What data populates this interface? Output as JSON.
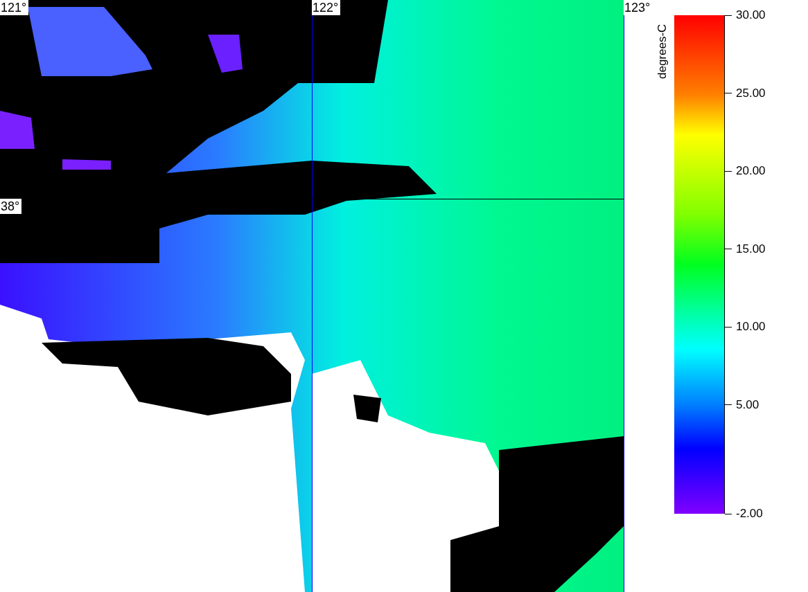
{
  "map": {
    "grid_labels": [
      {
        "kind": "lon",
        "text": "121°"
      },
      {
        "kind": "lon",
        "text": "122°"
      },
      {
        "kind": "lon",
        "text": "123°"
      },
      {
        "kind": "lat",
        "text": "38°"
      }
    ]
  },
  "colorbar": {
    "unit_label": "degrees-C",
    "ticks": [
      "30.00",
      "25.00",
      "20.00",
      "15.00",
      "10.00",
      "5.00",
      "-2.00"
    ]
  }
}
